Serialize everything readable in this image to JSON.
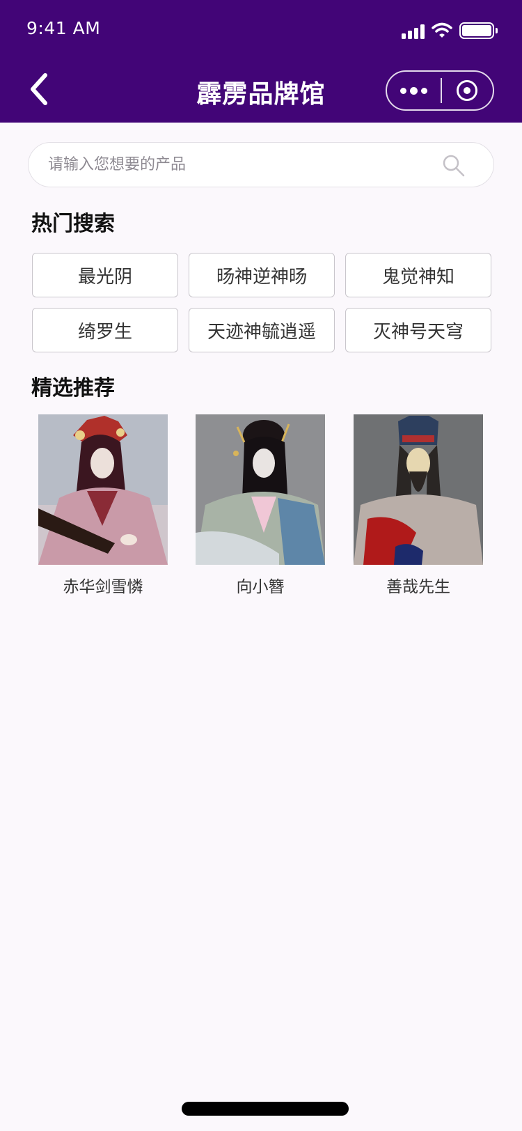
{
  "status_bar": {
    "time": "9:41 AM"
  },
  "nav": {
    "title": "霹雳品牌馆",
    "icons": {
      "back": "chevron-left-icon",
      "more": "more-dots-icon",
      "close": "target-close-icon"
    }
  },
  "search": {
    "placeholder": "请输入您想要的产品",
    "value": "",
    "icon": "search-icon"
  },
  "hot_search": {
    "title": "热门搜索",
    "tags": [
      "最光阴",
      "旸神逆神旸",
      "鬼觉神知",
      "绮罗生",
      "天迹神毓逍遥",
      "灭神号天穹"
    ]
  },
  "featured": {
    "title": "精选推荐",
    "items": [
      {
        "name": "赤华剑雪憐",
        "image": "puppet-photo-red-robe"
      },
      {
        "name": "向小簪",
        "image": "puppet-photo-blue-robe"
      },
      {
        "name": "善哉先生",
        "image": "puppet-photo-white-beard"
      }
    ]
  },
  "colors": {
    "header_bg": "#420577",
    "page_bg": "#fbf8fc",
    "tag_border": "#c9c6cc"
  }
}
